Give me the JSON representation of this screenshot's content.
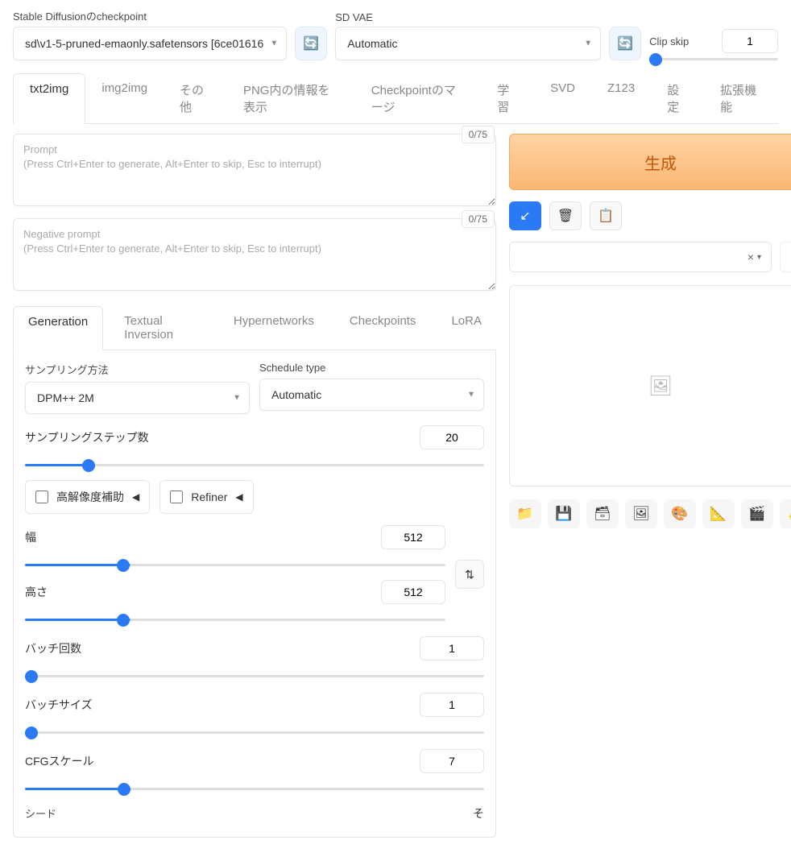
{
  "top": {
    "checkpoint_label": "Stable Diffusionのcheckpoint",
    "checkpoint_value": "sd\\v1-5-pruned-emaonly.safetensors [6ce01616",
    "vae_label": "SD VAE",
    "vae_value": "Automatic",
    "clip_skip_label": "Clip skip",
    "clip_skip_value": "1"
  },
  "tabs_main": [
    "txt2img",
    "img2img",
    "その他",
    "PNG内の情報を表示",
    "Checkpointのマージ",
    "学習",
    "SVD",
    "Z123",
    "設定",
    "拡張機能"
  ],
  "tabs_main_active": 0,
  "prompt": {
    "placeholder": "Prompt\n(Press Ctrl+Enter to generate, Alt+Enter to skip, Esc to interrupt)",
    "counter": "0/75"
  },
  "neg_prompt": {
    "placeholder": "Negative prompt\n(Press Ctrl+Enter to generate, Alt+Enter to skip, Esc to interrupt)",
    "counter": "0/75"
  },
  "tabs_sub": [
    "Generation",
    "Textual Inversion",
    "Hypernetworks",
    "Checkpoints",
    "LoRA"
  ],
  "tabs_sub_active": 0,
  "settings": {
    "sampler_label": "サンプリング方法",
    "sampler_value": "DPM++ 2M",
    "schedule_label": "Schedule type",
    "schedule_value": "Automatic",
    "steps_label": "サンプリングステップ数",
    "steps_value": "20",
    "hires_label": "高解像度補助",
    "refiner_label": "Refiner",
    "width_label": "幅",
    "width_value": "512",
    "height_label": "高さ",
    "height_value": "512",
    "batch_count_label": "バッチ回数",
    "batch_count_value": "1",
    "batch_size_label": "バッチサイズ",
    "batch_size_value": "1",
    "cfg_label": "CFGスケール",
    "cfg_value": "7",
    "seed_label": "シード",
    "seed_extra": "そ"
  },
  "right": {
    "generate_label": "生成",
    "action_icons": [
      "arrow",
      "trash",
      "clipboard"
    ],
    "style_clear": "×",
    "style_dropdown": "▾",
    "tool_icons": [
      "folder",
      "save",
      "box",
      "image",
      "palette",
      "ruler",
      "clapper",
      "sparkle"
    ]
  }
}
